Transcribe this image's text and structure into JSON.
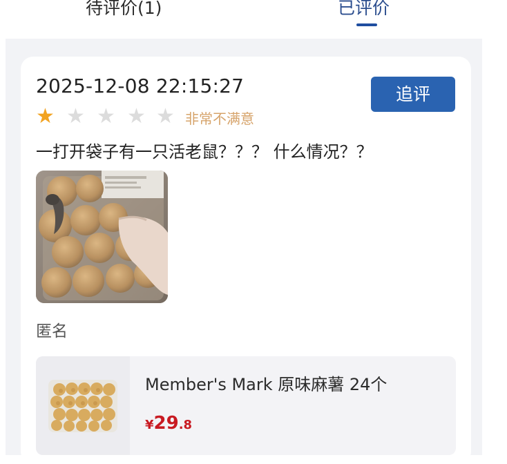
{
  "tabs": {
    "pending": "待评价(1)",
    "reviewed": "已评价"
  },
  "review": {
    "datetime": "2025-12-08 22:15:27",
    "followup_button": "追评",
    "rating_value": 1,
    "rating_max": 5,
    "rating_label": "非常不满意",
    "text": "一打开袋子有一只活老鼠？？？ 什么情况？？",
    "anonymous": "匿名"
  },
  "product": {
    "name": "Member's Mark 原味麻薯 24个",
    "price_symbol": "¥",
    "price_int": "29",
    "price_dec": ".8"
  },
  "colors": {
    "accent": "#2a63b1",
    "star_on": "#f2a321",
    "star_off": "#dcdcdc",
    "rating_text": "#d6a36a",
    "price": "#c81a22"
  }
}
